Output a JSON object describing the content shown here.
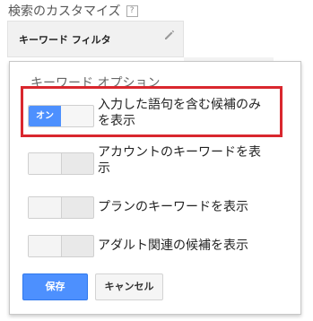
{
  "header": {
    "title": "検索のカスタマイズ",
    "help": "?"
  },
  "filter": {
    "label": "キーワード フィルタ",
    "edit_icon": "pencil-icon"
  },
  "panel": {
    "title": "キーワード オプション",
    "options": [
      {
        "label_line1": "入力した語句を含む候補のみ",
        "label_line2": "を表示",
        "toggle": "オン",
        "state": "on"
      },
      {
        "label_line1": "アカウントのキーワードを表",
        "label_line2": "示",
        "state": "off"
      },
      {
        "label": "プランのキーワードを表示",
        "state": "off"
      },
      {
        "label": "アダルト関連の候補を表示",
        "state": "off"
      }
    ],
    "save_label": "保存",
    "cancel_label": "キャンセル"
  },
  "colors": {
    "primary": "#4d90fe",
    "highlight": "#d9272e"
  }
}
